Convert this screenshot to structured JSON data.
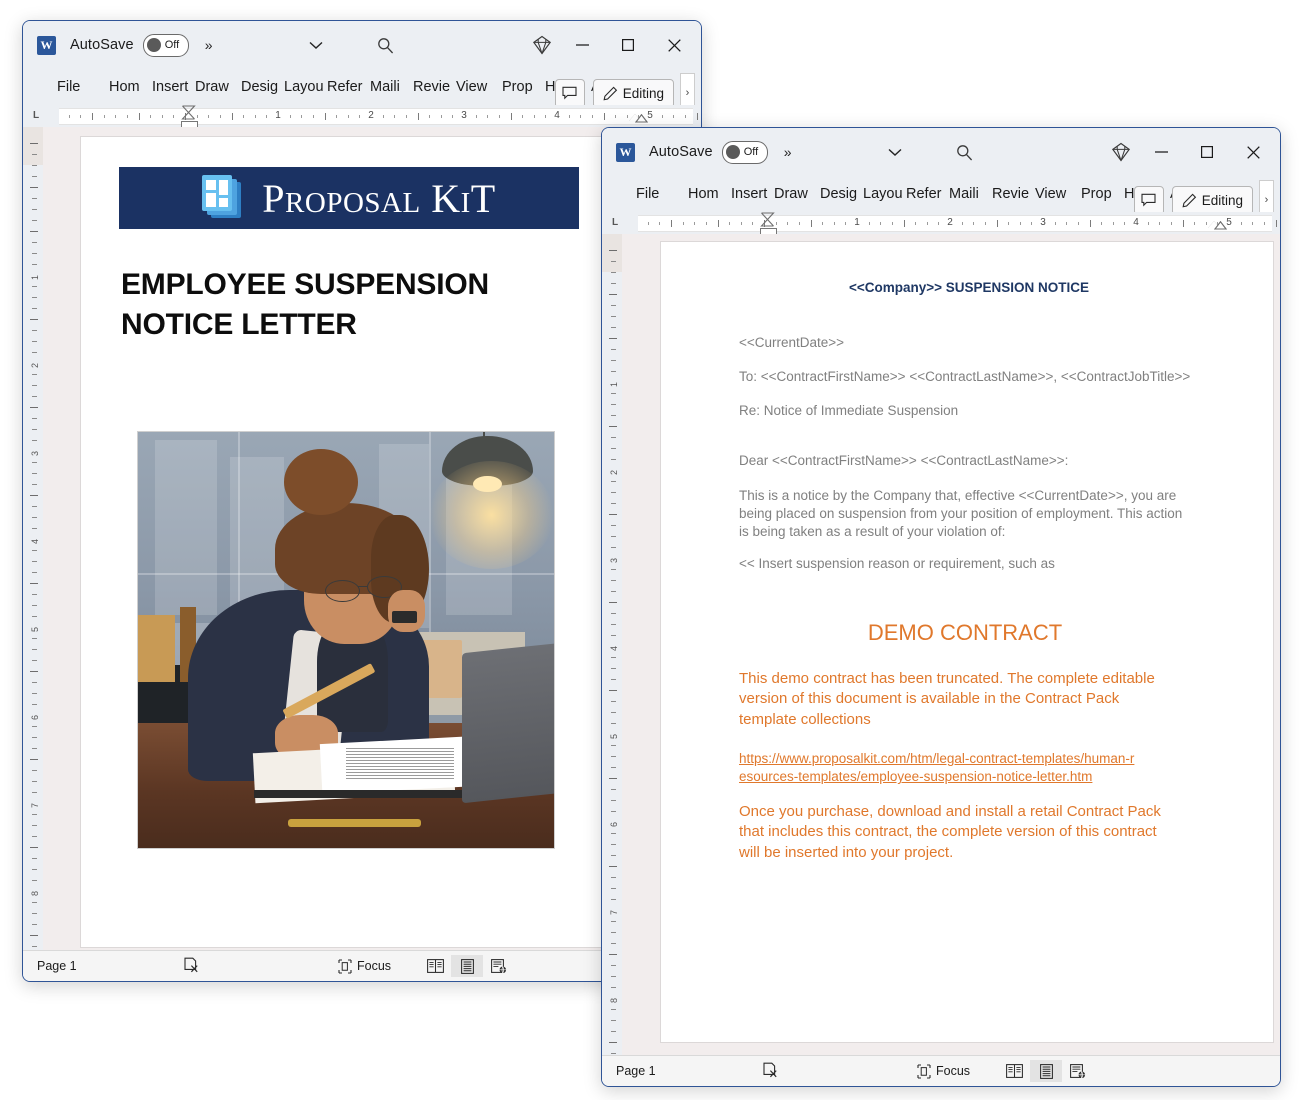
{
  "windows": [
    {
      "id": "word-window-back",
      "titlebar": {
        "app_icon": "word-icon",
        "app_icon_letter": "W",
        "autosave_label": "AutoSave",
        "autosave_state": "Off",
        "overflow_icon": "double-chevron-right-icon",
        "customize_icon": "chevron-down-icon",
        "search_icon": "search-icon",
        "copilot_icon": "diamond-icon",
        "minimize_icon": "minimize-icon",
        "maximize_icon": "maximize-icon",
        "close_icon": "close-icon"
      },
      "ribbon": {
        "tabs": [
          "File",
          "Home",
          "Insert",
          "Draw",
          "Design",
          "Layout",
          "References",
          "Mailings",
          "Review",
          "View",
          "Properties",
          "Help",
          "Acrobat"
        ],
        "tabs_clipped": [
          "File",
          "Hom",
          "Insert",
          "Draw",
          "Desig",
          "Layou",
          "Refer",
          "Maili",
          "Revie",
          "View",
          "Prop",
          "Help",
          "Acrob"
        ],
        "comment_icon": "comment-icon",
        "editing_label": "Editing",
        "editing_icon": "pencil-icon",
        "more_icon": "chevron-right-icon"
      },
      "ruler": {
        "origin_marker": "L",
        "numbers": [
          "1",
          "2",
          "3",
          "4",
          "5"
        ]
      },
      "statusbar": {
        "page_label": "Page 1",
        "proofing_icon": "proofing-errors-icon",
        "focus_label": "Focus",
        "focus_icon": "focus-icon",
        "view_read_icon": "read-mode-icon",
        "view_print_icon": "print-layout-icon",
        "view_web_icon": "web-layout-icon"
      },
      "document": {
        "banner_brand": "PROPOSAL KIT",
        "banner_brand_main": "P",
        "heading": "EMPLOYEE SUSPENSION NOTICE LETTER",
        "heading_line1": "EMPLOYEE SUSPENSION",
        "heading_line2": "NOTICE LETTER",
        "image_alt": "illustration-woman-at-desk-signing-document",
        "banner_color": "#1b3263",
        "logo_color": "#67c0f0"
      }
    },
    {
      "id": "word-window-front",
      "titlebar": {
        "app_icon": "word-icon",
        "app_icon_letter": "W",
        "autosave_label": "AutoSave",
        "autosave_state": "Off",
        "overflow_icon": "double-chevron-right-icon",
        "customize_icon": "chevron-down-icon",
        "search_icon": "search-icon",
        "copilot_icon": "diamond-icon",
        "minimize_icon": "minimize-icon",
        "maximize_icon": "maximize-icon",
        "close_icon": "close-icon"
      },
      "ribbon": {
        "tabs": [
          "File",
          "Home",
          "Insert",
          "Draw",
          "Design",
          "Layout",
          "References",
          "Mailings",
          "Review",
          "View",
          "Properties",
          "Help",
          "Acrobat"
        ],
        "tabs_clipped": [
          "File",
          "Hom",
          "Insert",
          "Draw",
          "Desig",
          "Layou",
          "Refer",
          "Maili",
          "Revie",
          "View",
          "Prop",
          "Help",
          "Acrob"
        ],
        "comment_icon": "comment-icon",
        "editing_label": "Editing",
        "editing_icon": "pencil-icon",
        "more_icon": "chevron-right-icon"
      },
      "ruler": {
        "origin_marker": "L",
        "numbers": [
          "1",
          "2",
          "3",
          "4",
          "5"
        ]
      },
      "statusbar": {
        "page_label": "Page 1",
        "proofing_icon": "proofing-errors-icon",
        "focus_label": "Focus",
        "focus_icon": "focus-icon",
        "view_read_icon": "read-mode-icon",
        "view_print_icon": "print-layout-icon",
        "view_web_icon": "web-layout-icon"
      },
      "document": {
        "title": "<<Company>> SUSPENSION NOTICE",
        "date_field": "<<CurrentDate>>",
        "to_line": "To: <<ContractFirstName>> <<ContractLastName>>, <<ContractJobTitle>>",
        "re_line": "Re: Notice of Immediate Suspension",
        "salutation": "Dear <<ContractFirstName>> <<ContractLastName>>:",
        "body_paragraph": "This is a notice by the Company that, effective <<CurrentDate>>, you are being placed on suspension from your position of employment. This action is being taken as a result of your violation of:",
        "insert_note": "<< Insert suspension reason or requirement, such as",
        "demo_heading": "DEMO CONTRACT",
        "demo_paragraph": "This demo contract has been truncated. The complete editable version of this document is available in the Contract Pack template collections",
        "demo_link": "https://www.proposalkit.com/htm/legal-contract-templates/human-resources-templates/employee-suspension-notice-letter.htm",
        "demo_closing": "Once you purchase, download and install a retail Contract Pack that includes this contract, the complete version of this contract will be inserted into your project.",
        "title_color": "#1f3864",
        "body_color": "#808080",
        "accent_color": "#e0782c"
      }
    }
  ]
}
